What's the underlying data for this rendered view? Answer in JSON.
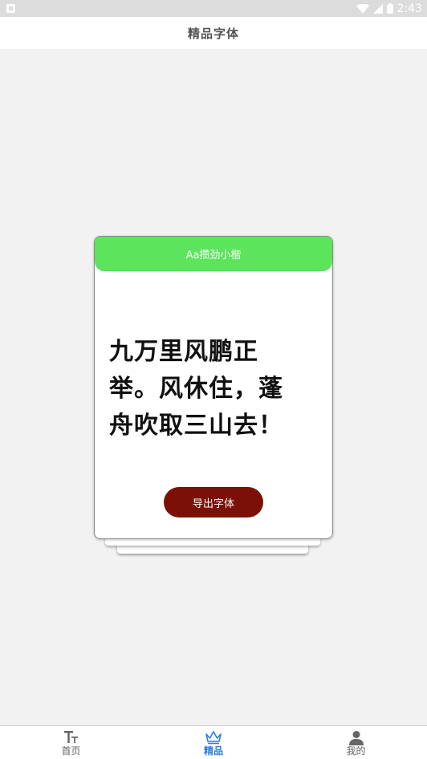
{
  "status_bar": {
    "time": "2:43"
  },
  "header": {
    "title": "精品字体"
  },
  "card": {
    "font_name": "Aa攒劲小楷",
    "preview_lines": [
      "九万里风鹏正",
      "举。风休住，蓬",
      "舟吹取三山去！"
    ],
    "export_label": "导出字体"
  },
  "nav": {
    "items": [
      {
        "label": "首页",
        "icon": "text-size-icon",
        "active": false
      },
      {
        "label": "精品",
        "icon": "crown-icon",
        "active": true
      },
      {
        "label": "我的",
        "icon": "person-icon",
        "active": false
      }
    ]
  },
  "colors": {
    "card_header": "#5de45d",
    "export_button": "#7b1106",
    "active_nav": "#2a7de1"
  }
}
